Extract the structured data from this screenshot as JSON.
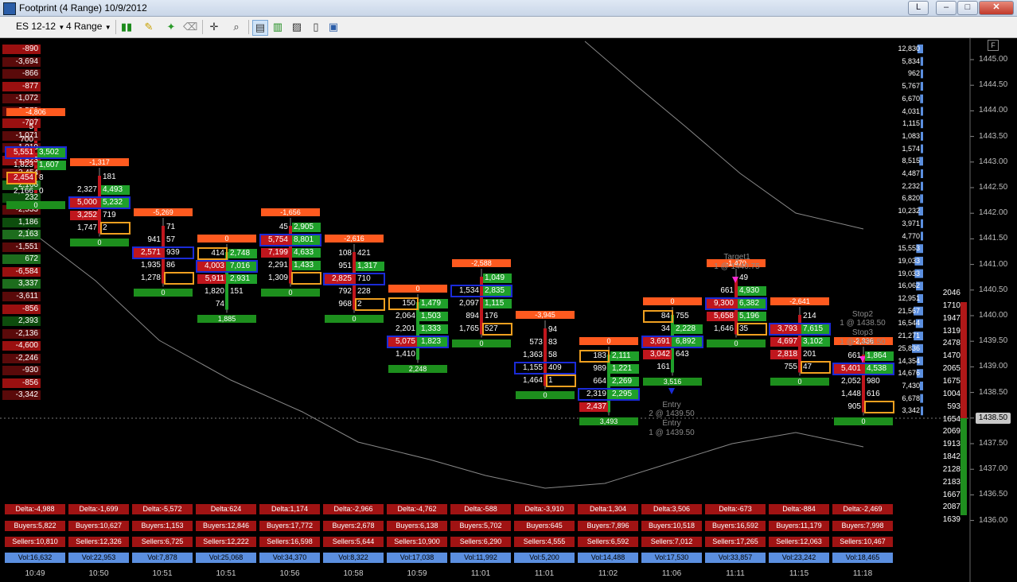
{
  "window": {
    "title": "Footprint (4 Range)  10/9/2012",
    "btn_l": "L",
    "btn_min": "–",
    "btn_max": "□",
    "btn_close": "✕"
  },
  "toolbar": {
    "instrument": "ES 12-12",
    "period": "4 Range",
    "icons": [
      "bar-style-icon",
      "pencil-icon",
      "tool-icon",
      "eraser-icon",
      "crosshair-icon",
      "zoom-icon",
      "properties-icon",
      "footprint-icon",
      "chart-icon",
      "data-box-icon",
      "indicator-icon"
    ]
  },
  "colors": {
    "up": "#1fa02a",
    "down": "#c0161d",
    "blue_box": "#1a2bd8",
    "orange_box": "#f0a020",
    "delta_bar": "#ff5a1f",
    "vol_bar": "#5b8fe0",
    "last_price": "#c8c8c8"
  },
  "price_axis": {
    "labels": [
      "1445.00",
      "1444.50",
      "1444.00",
      "1443.50",
      "1443.00",
      "1442.50",
      "1442.00",
      "1441.50",
      "1441.00",
      "1440.50",
      "1440.00",
      "1439.50",
      "1439.00",
      "1438.50",
      "1438.00",
      "1437.50",
      "1437.00",
      "1436.50",
      "1436.00"
    ],
    "last_price": "1438.50",
    "f_button": "F"
  },
  "left_delta_ladder": [
    "-890",
    "-3,694",
    "-866",
    "-877",
    "-1,072",
    "-2,579",
    "-707",
    "-1,071",
    "-1,019",
    "-1,823",
    "-2,454",
    "2,166",
    "232",
    "-2,533",
    "1,186",
    "2,163",
    "-1,551",
    "672",
    "-6,584",
    "3,337",
    "-3,611",
    "-856",
    "2,393",
    "-2,136",
    "-4,600",
    "-2,246",
    "-930",
    "-856",
    "-3,342"
  ],
  "right_volume_ladder": [
    "12,830",
    "5,834",
    "962",
    "5,767",
    "6,670",
    "4,031",
    "1,115",
    "1,083",
    "1,574",
    "8,515",
    "4,487",
    "2,232",
    "6,820",
    "10,232",
    "3,971",
    "4,770",
    "15,553",
    "19,033",
    "19,033",
    "16,062",
    "12,951",
    "21,567",
    "16,544",
    "21,271",
    "25,836",
    "14,354",
    "14,676",
    "7,430",
    "6,678",
    "3,342"
  ],
  "right_side_values": [
    "2046",
    "1710",
    "1947",
    "1319",
    "2478",
    "1470",
    "2065",
    "1675",
    "1004",
    "593",
    "1654",
    "2069",
    "1913",
    "1842",
    "2128",
    "2183",
    "1667",
    "2087",
    "1639"
  ],
  "annotations": {
    "target1": "Target1",
    "target1_qty": "1 @ 1440.75",
    "stop2": "Stop2",
    "stop2_qty": "1 @ 1438.50",
    "stop3": "Stop3",
    "stop3_qty": "1 @ 1438.50",
    "entry1": "Entry",
    "entry1_qty": "2 @ 1439.50",
    "entry2": "Entry",
    "entry2_qty": "1 @ 1439.50"
  },
  "bars": [
    {
      "time": "10:49",
      "delta_top": "-4,806",
      "delta_bottom": "0",
      "stats": {
        "delta": "Delta:-4,988",
        "buyers": "Buyers:5,822",
        "sellers": "Sellers:10,810",
        "vol": "Vol:16,632"
      },
      "rows": [
        [
          "5",
          "",
          ""
        ],
        [
          "700",
          "",
          ""
        ],
        [
          "5,551",
          "3,502",
          "b"
        ],
        [
          "1,823",
          "1,607",
          ""
        ],
        [
          "2,454",
          "8",
          "o"
        ],
        [
          "2,166",
          "0",
          ""
        ]
      ]
    },
    {
      "time": "10:50",
      "delta_top": "-1,317",
      "delta_bottom": "0",
      "stats": {
        "delta": "Delta:-1,699",
        "buyers": "Buyers:10,627",
        "sellers": "Sellers:12,326",
        "vol": "Vol:22,953"
      },
      "rows": [
        [
          "",
          "181",
          ""
        ],
        [
          "2,327",
          "4,493",
          ""
        ],
        [
          "5,000",
          "5,232",
          "b"
        ],
        [
          "3,252",
          "719",
          ""
        ],
        [
          "1,747",
          "2",
          "o"
        ]
      ]
    },
    {
      "time": "10:51",
      "delta_top": "-5,269",
      "delta_bottom": "0",
      "stats": {
        "delta": "Delta:-5,572",
        "buyers": "Buyers:1,153",
        "sellers": "Sellers:6,725",
        "vol": "Vol:7,878"
      },
      "rows": [
        [
          "",
          "71",
          ""
        ],
        [
          "941",
          "57",
          ""
        ],
        [
          "2,571",
          "939",
          "b"
        ],
        [
          "1,935",
          "86",
          ""
        ],
        [
          "1,278",
          "",
          "o"
        ]
      ]
    },
    {
      "time": "10:51",
      "delta_top": "0",
      "delta_bottom": "1,885",
      "stats": {
        "delta": "Delta:624",
        "buyers": "Buyers:12,846",
        "sellers": "Sellers:12,222",
        "vol": "Vol:25,068"
      },
      "rows": [
        [
          "414",
          "2,748",
          "o"
        ],
        [
          "4,003",
          "7,016",
          "b"
        ],
        [
          "5,911",
          "2,931",
          ""
        ],
        [
          "1,820",
          "151",
          ""
        ],
        [
          "74",
          "",
          ""
        ]
      ]
    },
    {
      "time": "10:56",
      "delta_top": "-1,656",
      "delta_bottom": "0",
      "stats": {
        "delta": "Delta:1,174",
        "buyers": "Buyers:17,772",
        "sellers": "Sellers:16,598",
        "vol": "Vol:34,370"
      },
      "rows": [
        [
          "45",
          "2,905",
          ""
        ],
        [
          "5,754",
          "8,801",
          "b"
        ],
        [
          "7,199",
          "4,633",
          ""
        ],
        [
          "2,291",
          "1,433",
          ""
        ],
        [
          "1,309",
          "",
          "o"
        ]
      ]
    },
    {
      "time": "10:58",
      "delta_top": "-2,616",
      "delta_bottom": "0",
      "stats": {
        "delta": "Delta:-2,966",
        "buyers": "Buyers:2,678",
        "sellers": "Sellers:5,644",
        "vol": "Vol:8,322"
      },
      "rows": [
        [
          "108",
          "421",
          ""
        ],
        [
          "951",
          "1,317",
          ""
        ],
        [
          "2,825",
          "710",
          "b"
        ],
        [
          "792",
          "228",
          ""
        ],
        [
          "968",
          "2",
          "o"
        ]
      ]
    },
    {
      "time": "10:59",
      "delta_top": "0",
      "delta_bottom": "2,248",
      "stats": {
        "delta": "Delta:-4,762",
        "buyers": "Buyers:6,138",
        "sellers": "Sellers:10,900",
        "vol": "Vol:17,038"
      },
      "rows": [
        [
          "150",
          "1,479",
          "o"
        ],
        [
          "2,064",
          "1,503",
          ""
        ],
        [
          "2,201",
          "1,333",
          ""
        ],
        [
          "5,075",
          "1,823",
          "b"
        ],
        [
          "1,410",
          "",
          ""
        ]
      ]
    },
    {
      "time": "11:01",
      "delta_top": "-2,588",
      "delta_bottom": "0",
      "stats": {
        "delta": "Delta:-588",
        "buyers": "Buyers:5,702",
        "sellers": "Sellers:6,290",
        "vol": "Vol:11,992"
      },
      "rows": [
        [
          "",
          "1,049",
          ""
        ],
        [
          "1,534",
          "2,835",
          "b"
        ],
        [
          "2,097",
          "1,115",
          ""
        ],
        [
          "894",
          "176",
          ""
        ],
        [
          "1,765",
          "527",
          "o"
        ]
      ]
    },
    {
      "time": "11:01",
      "delta_top": "-3,945",
      "delta_bottom": "0",
      "stats": {
        "delta": "Delta:-3,910",
        "buyers": "Buyers:645",
        "sellers": "Sellers:4,555",
        "vol": "Vol:5,200"
      },
      "rows": [
        [
          "",
          "94",
          ""
        ],
        [
          "573",
          "83",
          ""
        ],
        [
          "1,363",
          "58",
          ""
        ],
        [
          "1,155",
          "409",
          "b"
        ],
        [
          "1,464",
          "1",
          "o"
        ]
      ]
    },
    {
      "time": "11:02",
      "delta_top": "0",
      "delta_bottom": "3,493",
      "stats": {
        "delta": "Delta:1,304",
        "buyers": "Buyers:7,896",
        "sellers": "Sellers:6,592",
        "vol": "Vol:14,488"
      },
      "rows": [
        [
          "183",
          "2,111",
          "o"
        ],
        [
          "989",
          "1,221",
          ""
        ],
        [
          "664",
          "2,269",
          ""
        ],
        [
          "2,319",
          "2,295",
          "b"
        ],
        [
          "2,437",
          "",
          ""
        ]
      ]
    },
    {
      "time": "11:06",
      "delta_top": "0",
      "delta_bottom": "3,516",
      "stats": {
        "delta": "Delta:3,506",
        "buyers": "Buyers:10,518",
        "sellers": "Sellers:7,012",
        "vol": "Vol:17,530"
      },
      "rows": [
        [
          "84",
          "755",
          "o"
        ],
        [
          "34",
          "2,228",
          ""
        ],
        [
          "3,691",
          "6,892",
          "b"
        ],
        [
          "3,042",
          "643",
          ""
        ],
        [
          "161",
          "",
          ""
        ]
      ]
    },
    {
      "time": "11:11",
      "delta_top": "-1,470",
      "delta_bottom": "0",
      "stats": {
        "delta": "Delta:-673",
        "buyers": "Buyers:16,592",
        "sellers": "Sellers:17,265",
        "vol": "Vol:33,857"
      },
      "rows": [
        [
          "",
          "49",
          ""
        ],
        [
          "661",
          "4,930",
          ""
        ],
        [
          "9,300",
          "6,382",
          "b"
        ],
        [
          "5,658",
          "5,196",
          ""
        ],
        [
          "1,646",
          "35",
          "o"
        ]
      ]
    },
    {
      "time": "11:15",
      "delta_top": "-2,641",
      "delta_bottom": "0",
      "stats": {
        "delta": "Delta:-884",
        "buyers": "Buyers:11,179",
        "sellers": "Sellers:12,063",
        "vol": "Vol:23,242"
      },
      "rows": [
        [
          "",
          "214",
          ""
        ],
        [
          "3,793",
          "7,615",
          "b"
        ],
        [
          "4,697",
          "3,102",
          ""
        ],
        [
          "2,818",
          "201",
          ""
        ],
        [
          "755",
          "47",
          "o"
        ]
      ]
    },
    {
      "time": "11:18",
      "delta_top": "-2,336",
      "delta_bottom": "0",
      "stats": {
        "delta": "Delta:-2,469",
        "buyers": "Buyers:7,998",
        "sellers": "Sellers:10,467",
        "vol": "Vol:18,465"
      },
      "rows": [
        [
          "661",
          "1,864",
          ""
        ],
        [
          "5,401",
          "4,538",
          "b"
        ],
        [
          "2,052",
          "980",
          ""
        ],
        [
          "1,448",
          "616",
          ""
        ],
        [
          "905",
          "",
          "o"
        ]
      ]
    }
  ]
}
